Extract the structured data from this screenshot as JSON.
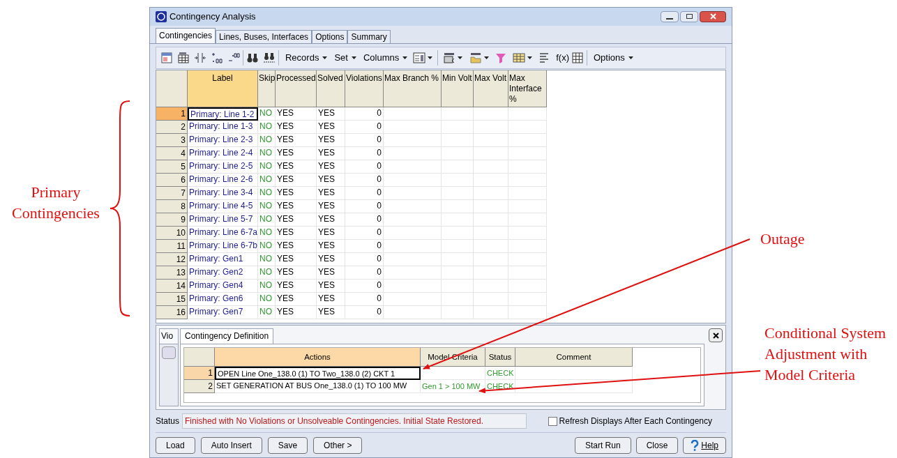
{
  "annotations": {
    "brace_label": "Primary Contingencies",
    "outage_label": "Outage",
    "conditional_label": "Conditional System Adjustment with Model Criteria"
  },
  "window": {
    "title": "Contingency Analysis"
  },
  "tabs": [
    {
      "label": "Contingencies",
      "selected": true
    },
    {
      "label": "Lines, Buses, Interfaces",
      "selected": false
    },
    {
      "label": "Options",
      "selected": false
    },
    {
      "label": "Summary",
      "selected": false
    }
  ],
  "toolbar": {
    "menus": [
      "Records",
      "Set",
      "Columns"
    ],
    "fx": "f(x)",
    "options": "Options"
  },
  "table": {
    "columns": [
      {
        "label": "Label",
        "kind": "label"
      },
      {
        "label": "Skip",
        "kind": "skip"
      },
      {
        "label": "Processed",
        "kind": "text"
      },
      {
        "label": "Solved",
        "kind": "text"
      },
      {
        "label": "Violations",
        "kind": "number"
      },
      {
        "label": "Max Branch %",
        "kind": "number"
      },
      {
        "label": "Min Volt",
        "kind": "number"
      },
      {
        "label": "Max Volt",
        "kind": "number"
      },
      {
        "label": "Max Interface %",
        "kind": "number"
      }
    ],
    "rows": [
      {
        "number": "1",
        "selected": true,
        "cells": [
          "Primary: Line 1-2",
          "NO",
          "YES",
          "YES",
          "0"
        ]
      },
      {
        "number": "2",
        "selected": false,
        "cells": [
          "Primary: Line 1-3",
          "NO",
          "YES",
          "YES",
          "0"
        ]
      },
      {
        "number": "3",
        "selected": false,
        "cells": [
          "Primary: Line 2-3",
          "NO",
          "YES",
          "YES",
          "0"
        ]
      },
      {
        "number": "4",
        "selected": false,
        "cells": [
          "Primary: Line 2-4",
          "NO",
          "YES",
          "YES",
          "0"
        ]
      },
      {
        "number": "5",
        "selected": false,
        "cells": [
          "Primary: Line 2-5",
          "NO",
          "YES",
          "YES",
          "0"
        ]
      },
      {
        "number": "6",
        "selected": false,
        "cells": [
          "Primary: Line 2-6",
          "NO",
          "YES",
          "YES",
          "0"
        ]
      },
      {
        "number": "7",
        "selected": false,
        "cells": [
          "Primary: Line 3-4",
          "NO",
          "YES",
          "YES",
          "0"
        ]
      },
      {
        "number": "8",
        "selected": false,
        "cells": [
          "Primary: Line 4-5",
          "NO",
          "YES",
          "YES",
          "0"
        ]
      },
      {
        "number": "9",
        "selected": false,
        "cells": [
          "Primary: Line 5-7",
          "NO",
          "YES",
          "YES",
          "0"
        ]
      },
      {
        "number": "10",
        "selected": false,
        "cells": [
          "Primary: Line 6-7a",
          "NO",
          "YES",
          "YES",
          "0"
        ]
      },
      {
        "number": "11",
        "selected": false,
        "cells": [
          "Primary: Line 6-7b",
          "NO",
          "YES",
          "YES",
          "0"
        ]
      },
      {
        "number": "12",
        "selected": false,
        "cells": [
          "Primary: Gen1",
          "NO",
          "YES",
          "YES",
          "0"
        ]
      },
      {
        "number": "13",
        "selected": false,
        "cells": [
          "Primary: Gen2",
          "NO",
          "YES",
          "YES",
          "0"
        ]
      },
      {
        "number": "14",
        "selected": false,
        "cells": [
          "Primary: Gen4",
          "NO",
          "YES",
          "YES",
          "0"
        ]
      },
      {
        "number": "15",
        "selected": false,
        "cells": [
          "Primary: Gen6",
          "NO",
          "YES",
          "YES",
          "0"
        ]
      },
      {
        "number": "16",
        "selected": false,
        "cells": [
          "Primary: Gen7",
          "NO",
          "YES",
          "YES",
          "0"
        ]
      }
    ]
  },
  "lower_panel": {
    "side_tab": "Vio",
    "tab": "Contingency Definition",
    "columns": [
      "Actions",
      "Model Criteria",
      "Status",
      "Comment"
    ],
    "rows": [
      {
        "number": "1",
        "selected": true,
        "action": "OPEN Line One_138.0 (1)  TO  Two_138.0 (2) CKT 1",
        "status": "CHECK"
      },
      {
        "number": "2",
        "selected": false,
        "action": "SET GENERATION AT BUS One_138.0 (1) TO 100 MW",
        "model_criteria": "Gen 1 > 100 MW",
        "status": "CHECK"
      }
    ]
  },
  "status_bar": {
    "label": "Status",
    "message": "Finished with No Violations or Unsolveable Contingencies. Initial State Restored.",
    "checkbox": {
      "label": "Refresh Displays After Each Contingency",
      "checked": false
    }
  },
  "buttons_left": [
    "Load",
    "Auto Insert",
    "Save",
    "Other >"
  ],
  "buttons_right": [
    {
      "label": "Start Run",
      "kind": "plain"
    },
    {
      "label": "Close",
      "kind": "plain"
    },
    {
      "label": "Help",
      "kind": "help"
    }
  ]
}
